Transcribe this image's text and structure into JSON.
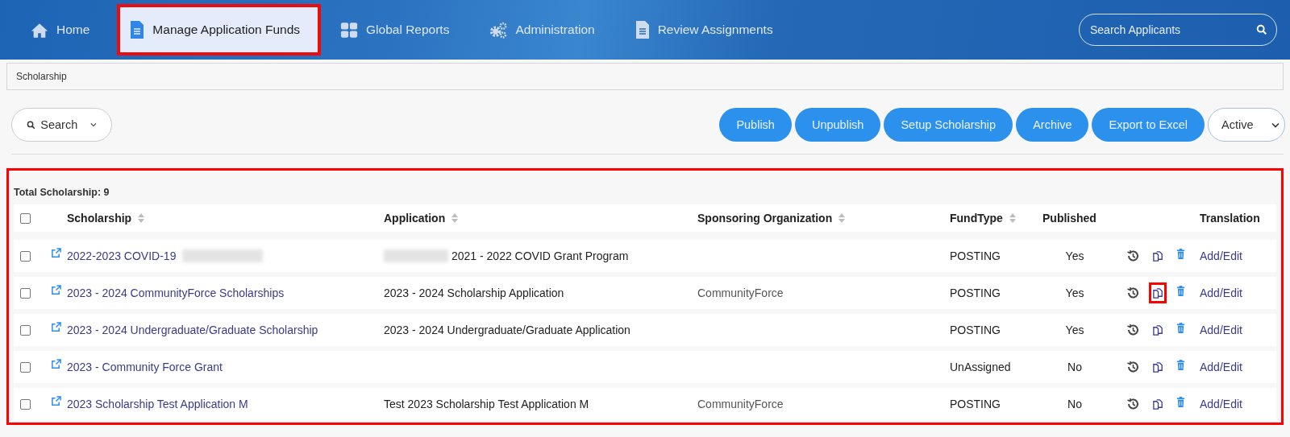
{
  "nav": {
    "items": [
      {
        "label": "Home",
        "kind": "home",
        "selected": false,
        "annotated": false
      },
      {
        "label": "Manage Application Funds",
        "kind": "document",
        "selected": true,
        "annotated": true
      },
      {
        "label": "Global Reports",
        "kind": "reports",
        "selected": false,
        "annotated": false
      },
      {
        "label": "Administration",
        "kind": "admin",
        "selected": false,
        "annotated": false
      },
      {
        "label": "Review Assignments",
        "kind": "document",
        "selected": false,
        "annotated": false
      }
    ],
    "search": {
      "placeholder": "Search Applicants"
    }
  },
  "breadcrumb": "Scholarship",
  "toolbar": {
    "search_button": "Search",
    "buttons": [
      "Publish",
      "Unpublish",
      "Setup Scholarship",
      "Archive",
      "Export to Excel"
    ],
    "status_filter": "Active"
  },
  "table": {
    "annotated": true,
    "total": "Total Scholarship: 9",
    "columns": [
      {
        "label": "Scholarship",
        "sortable": true
      },
      {
        "label": "Application",
        "sortable": true
      },
      {
        "label": "Sponsoring Organization",
        "sortable": true
      },
      {
        "label": "FundType",
        "sortable": true
      },
      {
        "label": "Published",
        "sortable": false
      },
      {
        "label": "Translation",
        "sortable": false
      }
    ],
    "rows": [
      {
        "checked": false,
        "scholarship": "2022-2023 COVID-19",
        "scholarship_blurred": true,
        "application": "2021 - 2022 COVID Grant Program",
        "application_blurred": true,
        "sponsor": "",
        "fund_type": "POSTING",
        "published": "Yes",
        "copy_annotated": false,
        "translation": "Add/Edit"
      },
      {
        "checked": false,
        "scholarship": "2023 - 2024 CommunityForce Scholarships",
        "scholarship_blurred": false,
        "application": "2023 - 2024 Scholarship Application",
        "application_blurred": false,
        "sponsor": "CommunityForce",
        "fund_type": "POSTING",
        "published": "Yes",
        "copy_annotated": true,
        "translation": "Add/Edit"
      },
      {
        "checked": false,
        "scholarship": "2023 - 2024 Undergraduate/Graduate Scholarship",
        "scholarship_blurred": false,
        "application": "2023 - 2024 Undergraduate/Graduate Application",
        "application_blurred": false,
        "sponsor": "",
        "fund_type": "POSTING",
        "published": "Yes",
        "copy_annotated": false,
        "translation": "Add/Edit"
      },
      {
        "checked": false,
        "scholarship": "2023 - Community Force Grant",
        "scholarship_blurred": false,
        "application": "",
        "application_blurred": false,
        "sponsor": "",
        "fund_type": "UnAssigned",
        "published": "No",
        "copy_annotated": false,
        "translation": "Add/Edit"
      },
      {
        "checked": false,
        "scholarship": "2023 Scholarship Test Application M",
        "scholarship_blurred": false,
        "application": "Test 2023 Scholarship Test Application M",
        "application_blurred": false,
        "sponsor": "CommunityForce",
        "fund_type": "POSTING",
        "published": "No",
        "copy_annotated": false,
        "translation": "Add/Edit"
      }
    ]
  }
}
